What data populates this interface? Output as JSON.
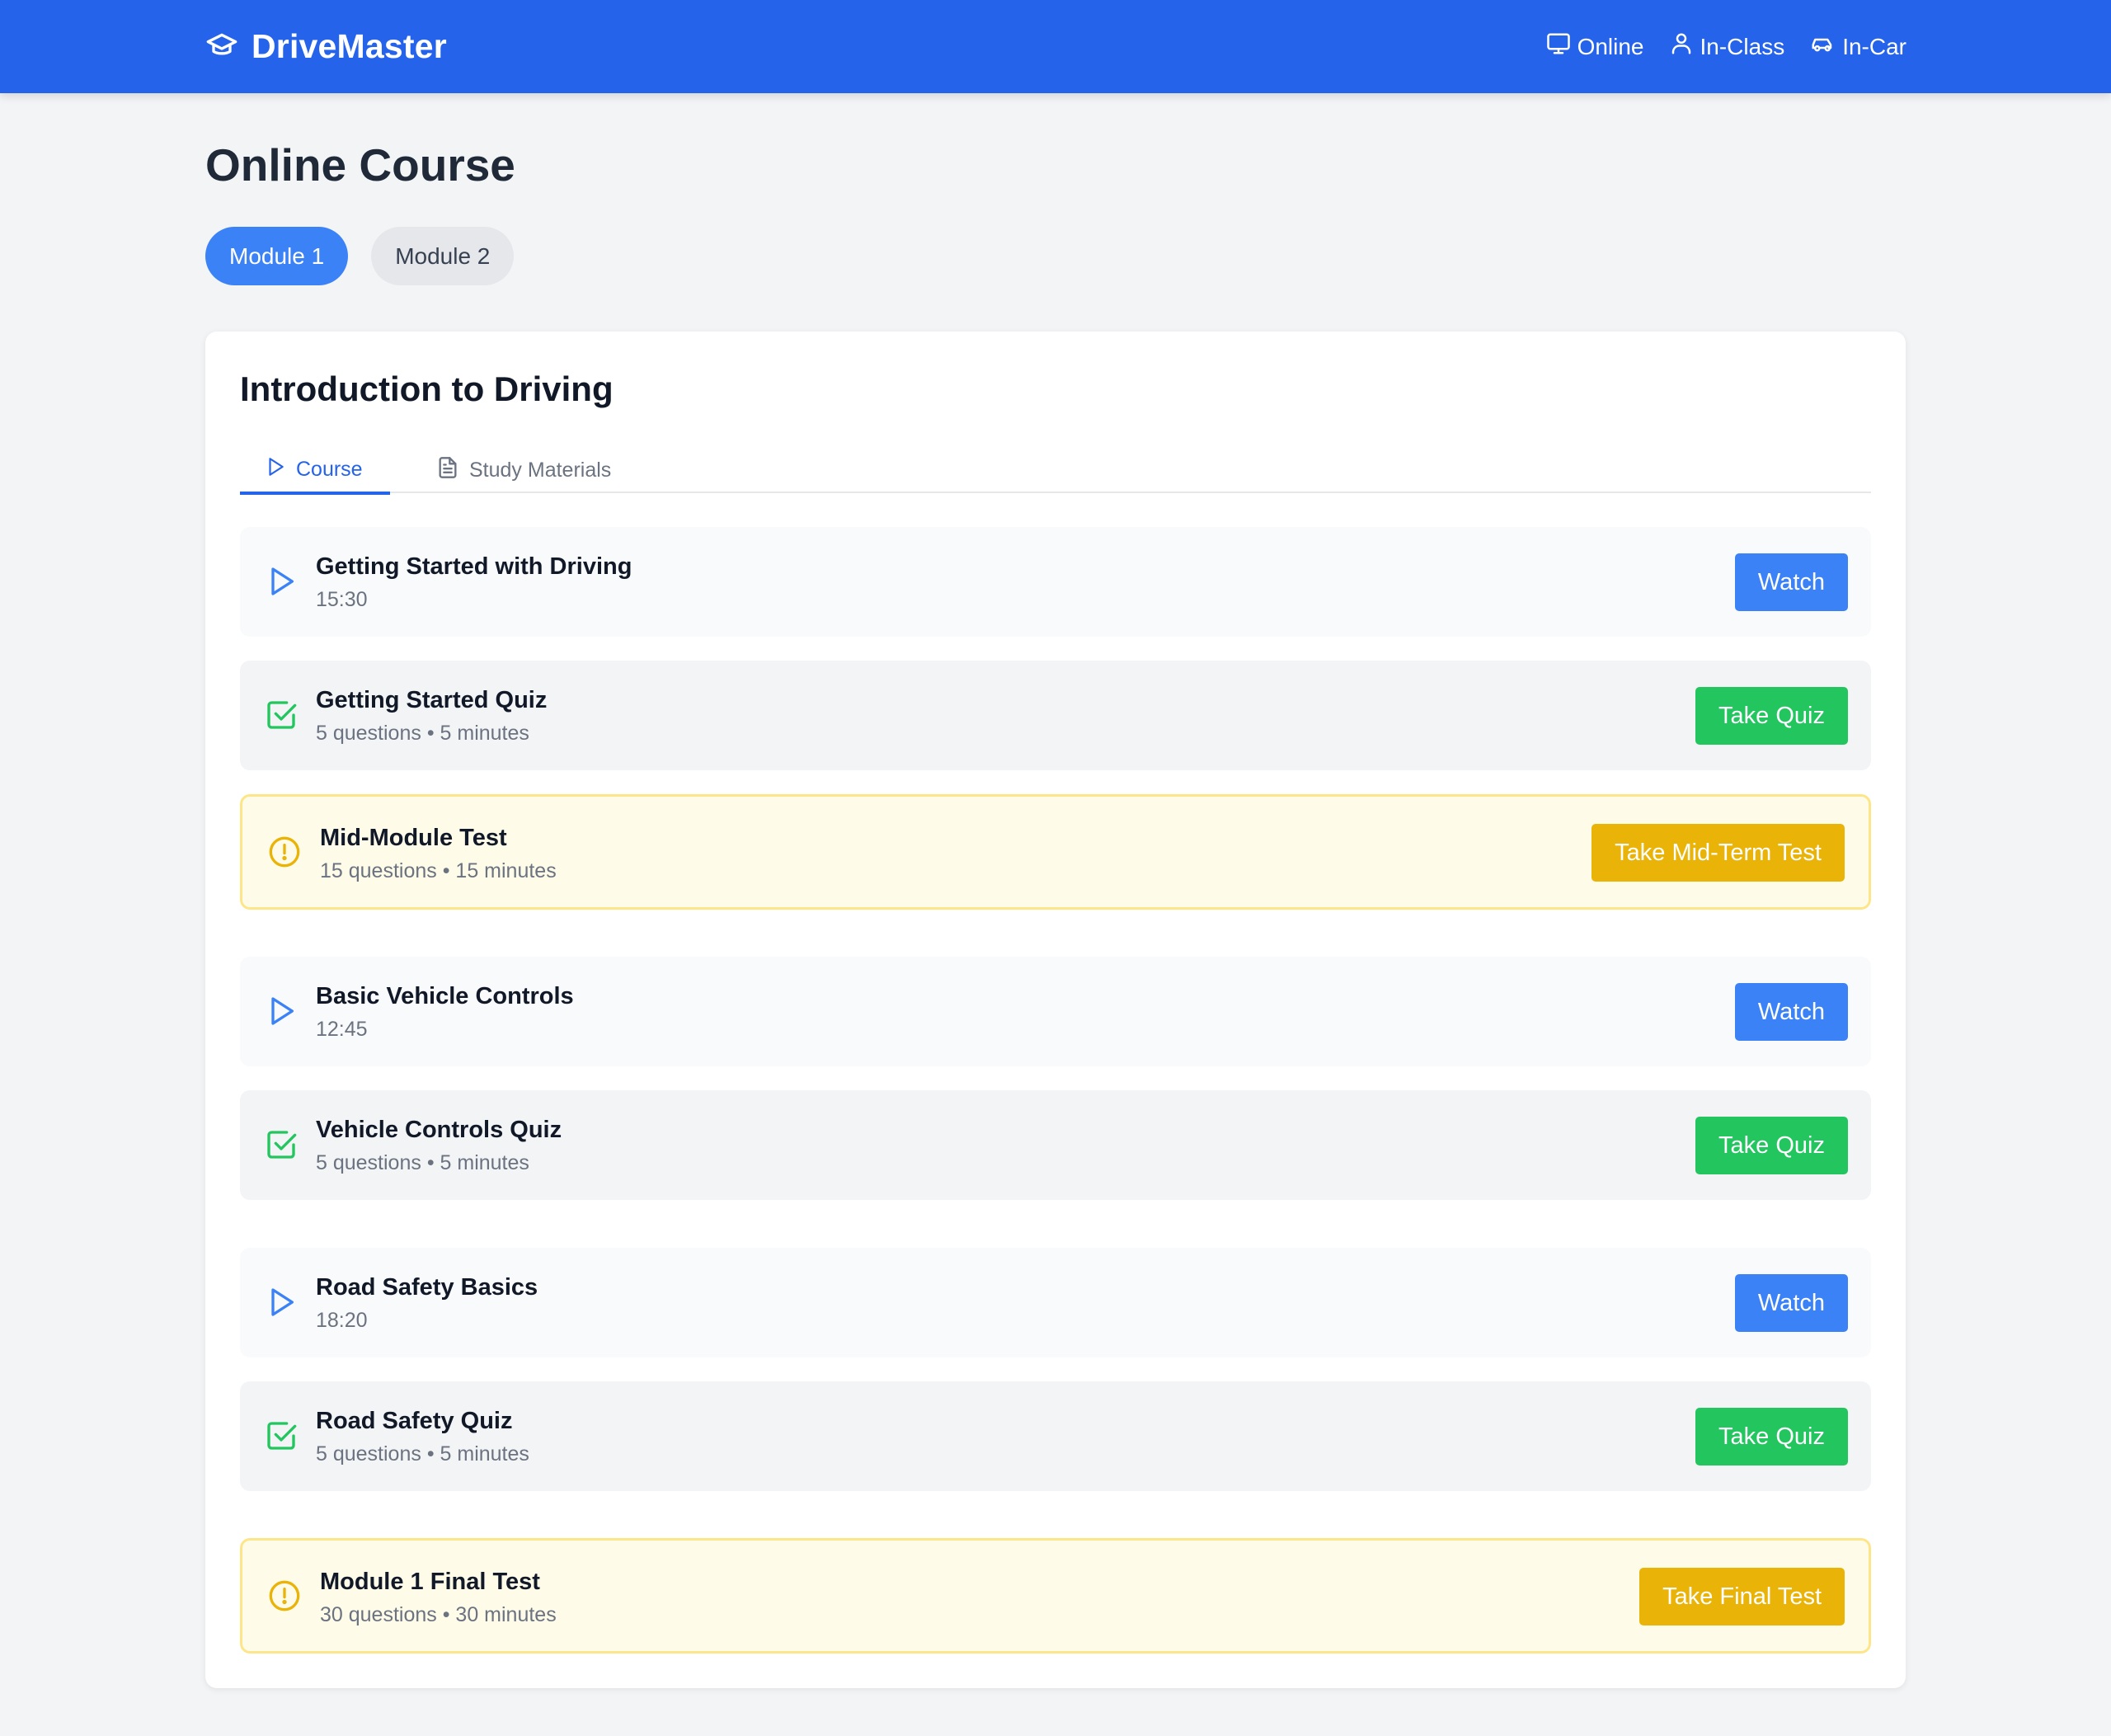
{
  "header": {
    "brand": "DriveMaster",
    "nav": [
      {
        "label": "Online",
        "icon": "monitor-icon"
      },
      {
        "label": "In-Class",
        "icon": "user-icon"
      },
      {
        "label": "In-Car",
        "icon": "car-icon"
      }
    ]
  },
  "page": {
    "title": "Online Course",
    "modules": [
      {
        "label": "Module 1",
        "active": true
      },
      {
        "label": "Module 2",
        "active": false
      }
    ]
  },
  "section": {
    "title": "Introduction to Driving",
    "tabs": [
      {
        "label": "Course",
        "icon": "play-icon",
        "active": true
      },
      {
        "label": "Study Materials",
        "icon": "document-icon",
        "active": false
      }
    ],
    "items": [
      {
        "type": "video",
        "title": "Getting Started with Driving",
        "subtitle": "15:30",
        "action": "Watch"
      },
      {
        "type": "quiz",
        "title": "Getting Started Quiz",
        "subtitle": "5 questions • 5 minutes",
        "action": "Take Quiz"
      },
      {
        "type": "test",
        "title": "Mid-Module Test",
        "subtitle": "15 questions • 15 minutes",
        "action": "Take Mid-Term Test"
      },
      {
        "type": "video",
        "title": "Basic Vehicle Controls",
        "subtitle": "12:45",
        "action": "Watch"
      },
      {
        "type": "quiz",
        "title": "Vehicle Controls Quiz",
        "subtitle": "5 questions • 5 minutes",
        "action": "Take Quiz"
      },
      {
        "type": "video",
        "title": "Road Safety Basics",
        "subtitle": "18:20",
        "action": "Watch"
      },
      {
        "type": "quiz",
        "title": "Road Safety Quiz",
        "subtitle": "5 questions • 5 minutes",
        "action": "Take Quiz"
      },
      {
        "type": "test",
        "title": "Module 1 Final Test",
        "subtitle": "30 questions • 30 minutes",
        "action": "Take Final Test"
      }
    ]
  },
  "colors": {
    "primary": "#2563eb",
    "button_blue": "#3b82f6",
    "button_green": "#22c55e",
    "button_yellow": "#eab308",
    "test_background": "#fefce8"
  }
}
